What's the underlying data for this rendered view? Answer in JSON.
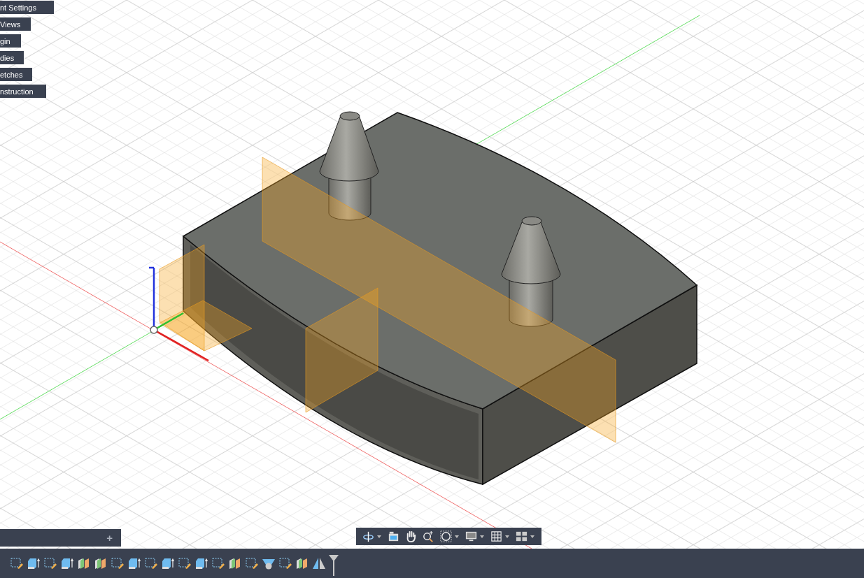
{
  "browser": {
    "items": [
      {
        "label": "nt Settings"
      },
      {
        "label": "Views"
      },
      {
        "label": "gin"
      },
      {
        "label": "dies"
      },
      {
        "label": "etches"
      },
      {
        "label": "nstruction"
      }
    ]
  },
  "comments_panel": {
    "add_label": "+"
  },
  "navigation_bar": {
    "tools": [
      {
        "kind": "orbit",
        "has_menu": true
      },
      {
        "kind": "look",
        "has_menu": false
      },
      {
        "kind": "pan",
        "has_menu": false
      },
      {
        "kind": "zoom",
        "has_menu": false
      },
      {
        "kind": "fit",
        "has_menu": true
      },
      {
        "kind": "display",
        "has_menu": true
      },
      {
        "kind": "grid",
        "has_menu": true
      },
      {
        "kind": "viewports",
        "has_menu": true
      }
    ]
  },
  "timeline": {
    "features": [
      {
        "kind": "sketch"
      },
      {
        "kind": "extrude"
      },
      {
        "kind": "sketch"
      },
      {
        "kind": "extrude"
      },
      {
        "kind": "plane"
      },
      {
        "kind": "plane"
      },
      {
        "kind": "sketch"
      },
      {
        "kind": "extrude"
      },
      {
        "kind": "sketch"
      },
      {
        "kind": "extrude"
      },
      {
        "kind": "sketch"
      },
      {
        "kind": "extrude"
      },
      {
        "kind": "sketch"
      },
      {
        "kind": "plane"
      },
      {
        "kind": "sketch"
      },
      {
        "kind": "shell"
      },
      {
        "kind": "sketch"
      },
      {
        "kind": "plane"
      },
      {
        "kind": "mirror"
      }
    ]
  }
}
